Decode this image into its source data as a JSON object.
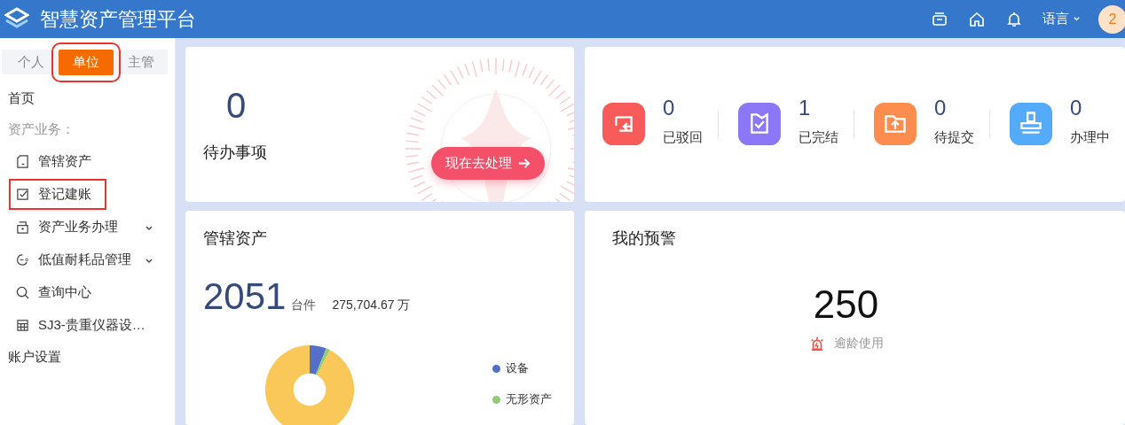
{
  "header": {
    "title": "智慧资产管理平台",
    "language": "语言",
    "avatar": "2"
  },
  "sidebar": {
    "tabs": [
      {
        "label": "个人",
        "selected": false,
        "highlighted": false
      },
      {
        "label": "单位",
        "selected": true,
        "highlighted": true
      },
      {
        "label": "主管",
        "selected": false,
        "highlighted": false
      }
    ],
    "items": [
      {
        "kind": "link",
        "label": "首页",
        "highlighted": false
      },
      {
        "kind": "group",
        "label": "资产业务：",
        "highlighted": false
      },
      {
        "kind": "item",
        "label": "管辖资产",
        "highlighted": false
      },
      {
        "kind": "item",
        "label": "登记建账",
        "highlighted": true
      },
      {
        "kind": "submenu",
        "label": "资产业务办理",
        "expanded": false,
        "highlighted": false
      },
      {
        "kind": "submenu",
        "label": "低值耐耗品管理",
        "expanded": false,
        "highlighted": false
      },
      {
        "kind": "item",
        "label": "查询中心",
        "highlighted": false
      },
      {
        "kind": "item",
        "label": "SJ3-贵重仪器设…",
        "highlighted": false
      },
      {
        "kind": "link",
        "label": "账户设置",
        "highlighted": false
      }
    ]
  },
  "todo": {
    "count": "0",
    "title": "待办事项",
    "button": "现在去处理"
  },
  "stats": [
    {
      "value": "0",
      "label": "已驳回",
      "color": "#f95a5a"
    },
    {
      "value": "1",
      "label": "已完结",
      "color": "#8c78f7"
    },
    {
      "value": "0",
      "label": "待提交",
      "color": "#fd8c4f"
    },
    {
      "value": "0",
      "label": "办理中",
      "color": "#55abfb"
    }
  ],
  "assets": {
    "title": "管辖资产",
    "count": "2051",
    "unit": "台件",
    "amount": "275,704.67 万",
    "legend": [
      {
        "label": "设备",
        "color": "#5470c6"
      },
      {
        "label": "无形资产",
        "color": "#91cc75"
      }
    ]
  },
  "warning": {
    "title": "我的预警",
    "count": "250",
    "label": "逾龄使用"
  }
}
